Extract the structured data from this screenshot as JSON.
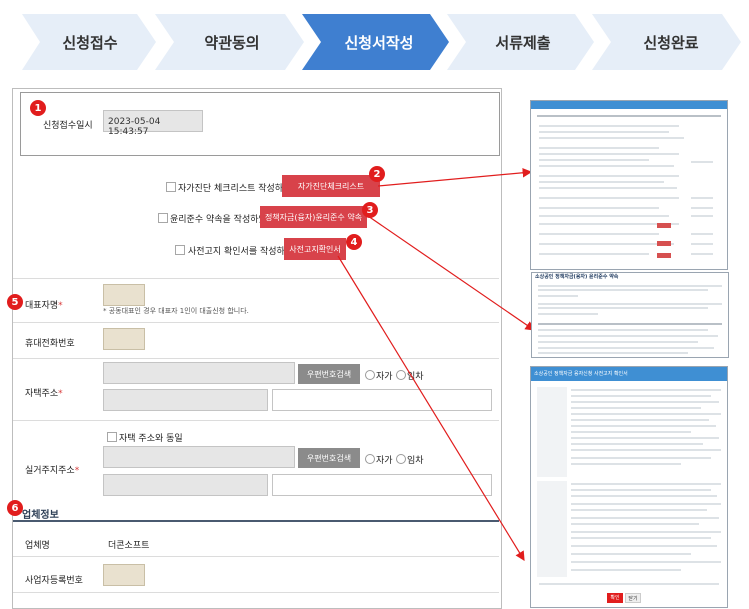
{
  "steps": [
    {
      "label": "신청접수",
      "active": false
    },
    {
      "label": "약관동의",
      "active": false
    },
    {
      "label": "신청서작성",
      "active": true
    },
    {
      "label": "서류제출",
      "active": false
    },
    {
      "label": "신청완료",
      "active": false
    }
  ],
  "colors": {
    "step_active": "#3f7fd0",
    "step_inactive": "#e6eef8",
    "button_red": "#d8424a",
    "badge": "#e11d1d"
  },
  "form": {
    "date_label": "신청접수일시",
    "date_value": "2023-05-04 15:43:57",
    "checklist_text": "자가진단 체크리스트 작성하였음",
    "checklist_button": "자가진단체크리스트",
    "ethics_text": "윤리준수 약속을 작성하였음",
    "ethics_button": "정책자금(융자)윤리준수 약속",
    "notice_text": "사전고지 확인서를 작성하였음",
    "notice_button": "사전고지확인서",
    "rep_label": "대표자명",
    "rep_note": "* 공동대표인 경우 대표자 1인이 대출신청 합니다.",
    "phone_label": "휴대전화번호",
    "home_address_label": "자택주소",
    "postal_search_button": "우편번호검색",
    "radio_own": "자가",
    "radio_rent": "임차",
    "same_as_home": "자택 주소와 동일",
    "residence_label": "실거주지주소",
    "company_section": "업체정보",
    "company_name_label": "업체명",
    "company_name_value": "더콘소프트",
    "biz_reg_label": "사업자등록번호"
  },
  "badges": [
    "1",
    "2",
    "3",
    "4",
    "5",
    "6"
  ],
  "popups": {
    "ethics_title": "소상공인 정책자금(융자) 윤리준수 약속",
    "notice_title": "소상공인 정책자금 융자신청 사전고지 확인서",
    "notice_button_confirm": "확인",
    "notice_button_close": "닫기"
  }
}
